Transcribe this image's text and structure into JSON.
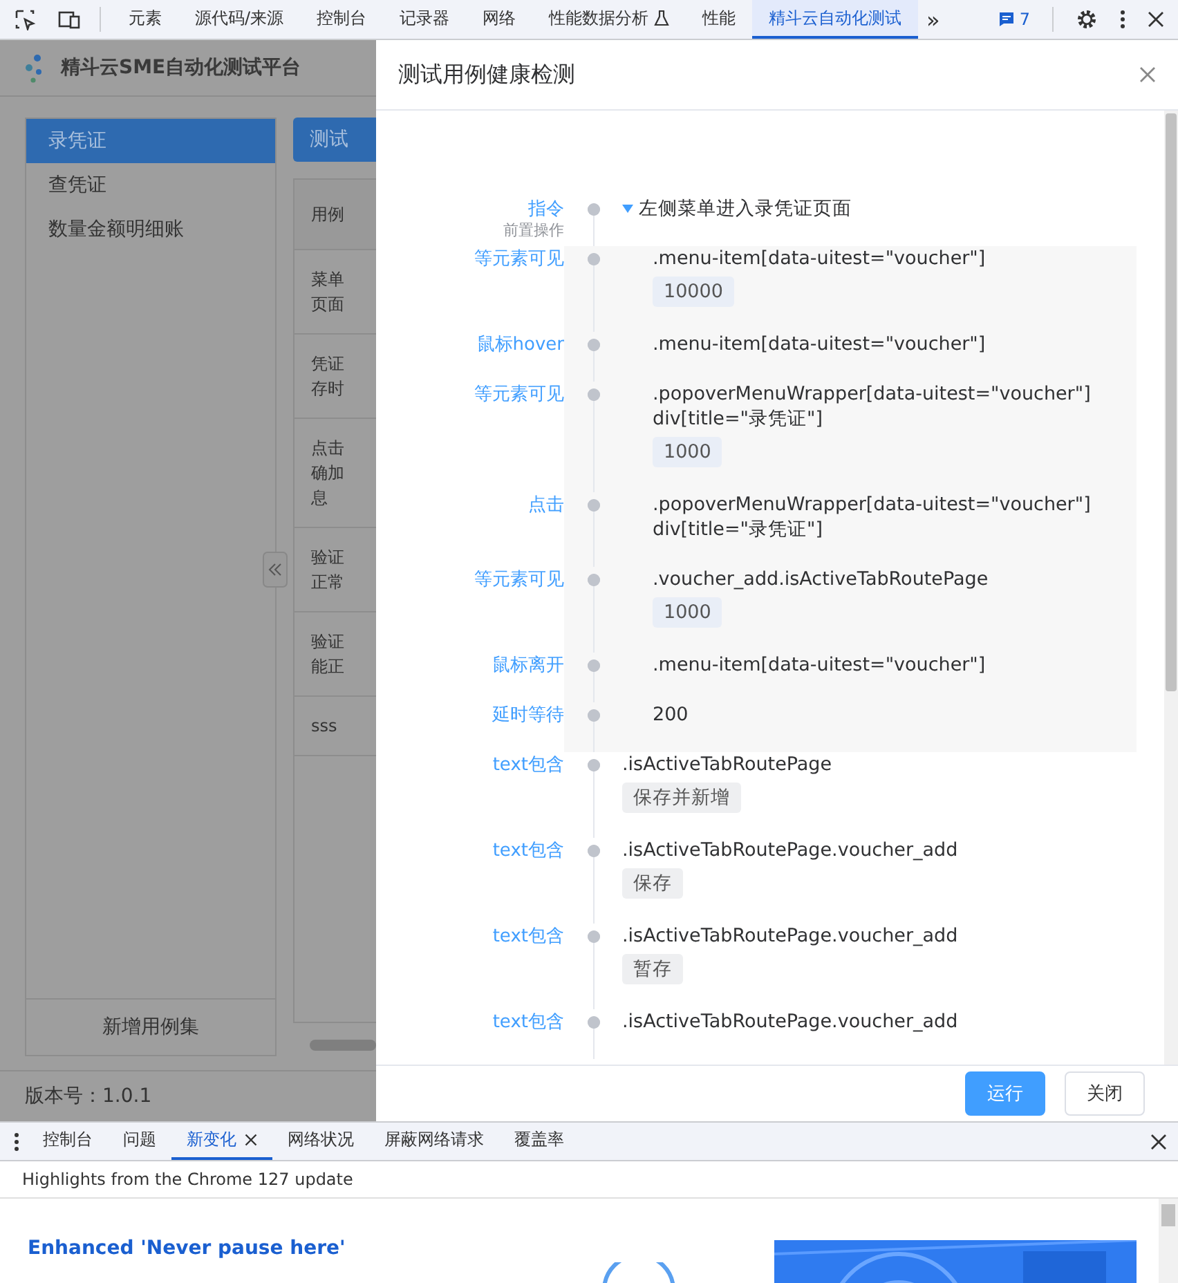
{
  "devtools_tabs": [
    {
      "label": "元素",
      "selected": false
    },
    {
      "label": "源代码/来源",
      "selected": false
    },
    {
      "label": "控制台",
      "selected": false
    },
    {
      "label": "记录器",
      "selected": false
    },
    {
      "label": "网络",
      "selected": false
    },
    {
      "label": "性能数据分析",
      "selected": false,
      "kind": "experimental"
    },
    {
      "label": "性能",
      "selected": false
    },
    {
      "label": "精斗云自动化测试",
      "selected": true
    }
  ],
  "devtools_overflow": "»",
  "issues_count": "7",
  "app": {
    "title": "精斗云SME自动化测试平台",
    "sidebar": {
      "items": [
        {
          "label": "录凭证",
          "selected": true
        },
        {
          "label": "查凭证",
          "selected": false
        },
        {
          "label": "数量金额明细账",
          "selected": false
        }
      ],
      "add_button": "新增用例集"
    },
    "tab_button": "测试",
    "table": {
      "header": "用例",
      "rows": [
        [
          "菜单",
          "页面"
        ],
        [
          "凭证",
          "存时"
        ],
        [
          "点击",
          "确加",
          "息"
        ],
        [
          "验证",
          "正常"
        ],
        [
          "验证",
          "能正"
        ],
        [
          "sss"
        ]
      ]
    },
    "version": "版本号：1.0.1"
  },
  "drawer": {
    "title": "测试用例健康检测",
    "steps": [
      {
        "kind": "directive",
        "label": "指令",
        "sublabel": "前置操作",
        "lines": [
          "左侧菜单进入录凭证页面"
        ]
      },
      {
        "kind": "nested",
        "label": "等元素可见",
        "lines": [
          ".menu-item[data-uitest=\"voucher\"]"
        ],
        "value": "10000"
      },
      {
        "kind": "nested",
        "label": "鼠标hover",
        "lines": [
          ".menu-item[data-uitest=\"voucher\"]"
        ]
      },
      {
        "kind": "nested",
        "label": "等元素可见",
        "lines": [
          ".popoverMenuWrapper[data-uitest=\"voucher\"]",
          "div[title=\"录凭证\"]"
        ],
        "value": "1000"
      },
      {
        "kind": "nested",
        "label": "点击",
        "lines": [
          ".popoverMenuWrapper[data-uitest=\"voucher\"]",
          "div[title=\"录凭证\"]"
        ]
      },
      {
        "kind": "nested",
        "label": "等元素可见",
        "lines": [
          ".voucher_add.isActiveTabRoutePage"
        ],
        "value": "1000"
      },
      {
        "kind": "nested",
        "label": "鼠标离开",
        "lines": [
          ".menu-item[data-uitest=\"voucher\"]"
        ]
      },
      {
        "kind": "nested",
        "label": "延时等待",
        "lines": [
          "200"
        ]
      },
      {
        "kind": "check",
        "label": "text包含",
        "lines": [
          ".isActiveTabRoutePage"
        ],
        "value": "保存并新增"
      },
      {
        "kind": "check",
        "label": "text包含",
        "lines": [
          ".isActiveTabRoutePage.voucher_add"
        ],
        "value": "保存"
      },
      {
        "kind": "check",
        "label": "text包含",
        "lines": [
          ".isActiveTabRoutePage.voucher_add"
        ],
        "value": "暂存"
      },
      {
        "kind": "check",
        "label": "text包含",
        "lines": [
          ".isActiveTabRoutePage.voucher_add"
        ]
      }
    ],
    "buttons": [
      {
        "label": "运行",
        "kind": "primary"
      },
      {
        "label": "关闭",
        "kind": "default"
      }
    ]
  },
  "console_drawer": {
    "tabs": [
      {
        "label": "控制台",
        "selected": false,
        "closable": false
      },
      {
        "label": "问题",
        "selected": false,
        "closable": false
      },
      {
        "label": "新变化",
        "selected": true,
        "closable": true
      },
      {
        "label": "网络状况",
        "selected": false,
        "closable": false
      },
      {
        "label": "屏蔽网络请求",
        "selected": false,
        "closable": false
      },
      {
        "label": "覆盖率",
        "selected": false,
        "closable": false
      }
    ],
    "subtitle": "Highlights from the Chrome 127 update",
    "heading": "Enhanced 'Never pause here'"
  }
}
